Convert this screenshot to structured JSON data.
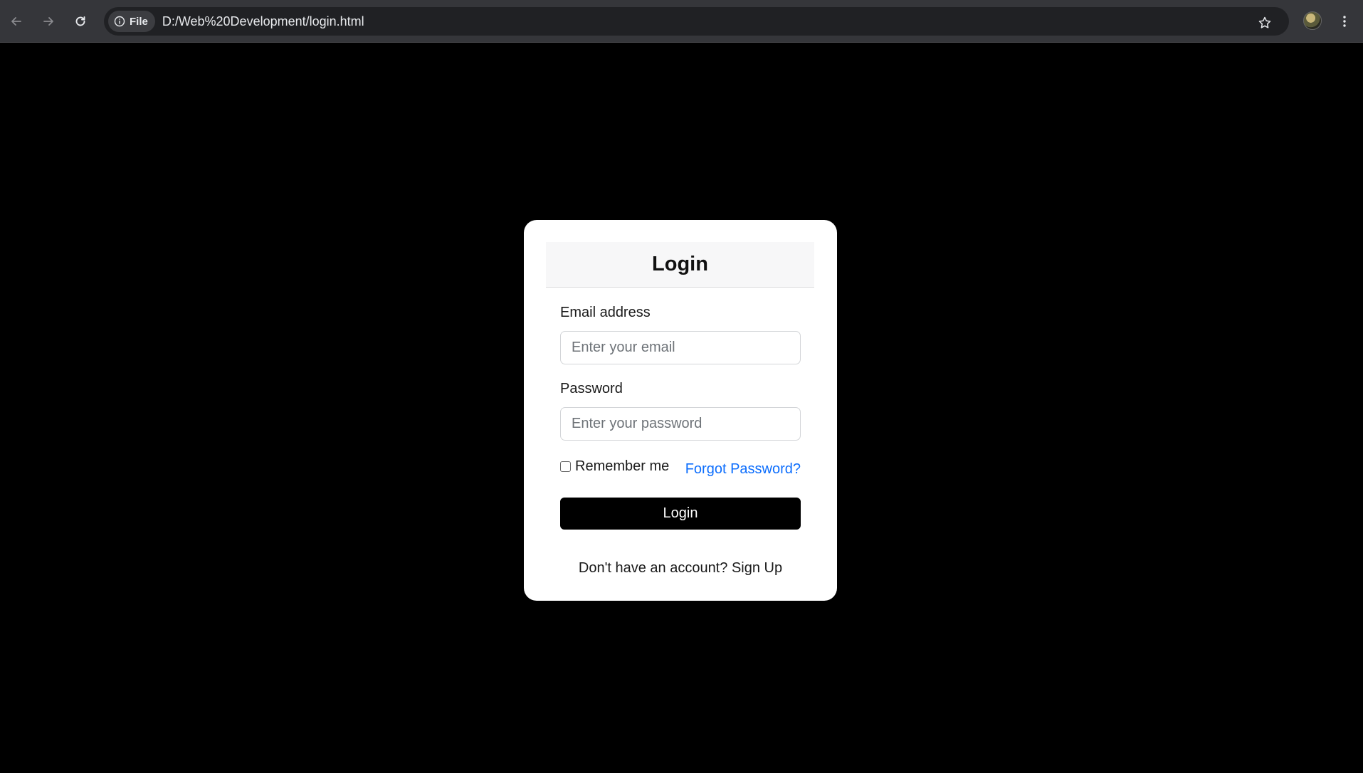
{
  "browser": {
    "site_chip_label": "File",
    "url": "D:/Web%20Development/login.html",
    "icons": {
      "back": "arrow-left-icon",
      "forward": "arrow-right-icon",
      "reload": "reload-icon",
      "info": "info-icon",
      "bookmark": "star-icon",
      "menu": "kebab-menu-icon"
    }
  },
  "login_card": {
    "title": "Login",
    "email_label": "Email address",
    "email_placeholder": "Enter your email",
    "password_label": "Password",
    "password_placeholder": "Enter your password",
    "remember_label": "Remember me",
    "remember_checked": false,
    "forgot_link": "Forgot Password?",
    "submit_label": "Login",
    "signup_prompt": "Don't have an account?",
    "signup_link": "Sign Up"
  },
  "colors": {
    "page_background": "#000000",
    "card_background": "#ffffff",
    "link": "#0d6efd",
    "button_background": "#000000",
    "button_text": "#ffffff"
  }
}
